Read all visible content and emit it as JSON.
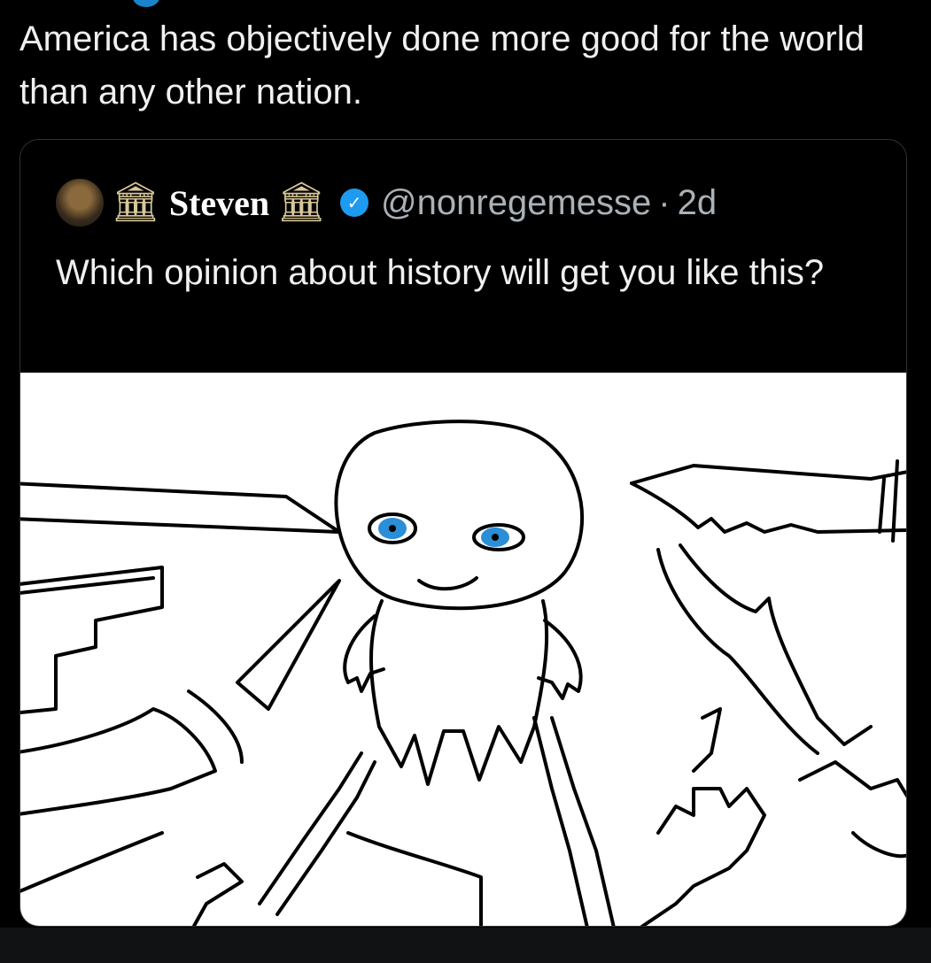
{
  "tweet": {
    "text": "America has objectively done more good for the world than any other nation."
  },
  "quoted_tweet": {
    "display_name": "Steven",
    "handle": "@nonregemesse",
    "separator": "·",
    "time": "2d",
    "text": "Which opinion about history will get you like this?",
    "name_icons": [
      "classical-building-icon",
      "classical-building-icon"
    ],
    "verified": true,
    "verified_color": "#1d9bf0",
    "image": {
      "description_icon": "meme-drawing",
      "subject": "smiling-blob-character",
      "surrounding_objects": [
        "sword",
        "pistol",
        "dagger",
        "knife",
        "machete",
        "axe",
        "spear"
      ],
      "eye_color": "#2a8fd6"
    }
  },
  "colors": {
    "background": "#000000",
    "text": "#e7e9ea",
    "secondary_text": "#aab1b7",
    "card_border": "#2f3336",
    "accent": "#1d9bf0"
  }
}
